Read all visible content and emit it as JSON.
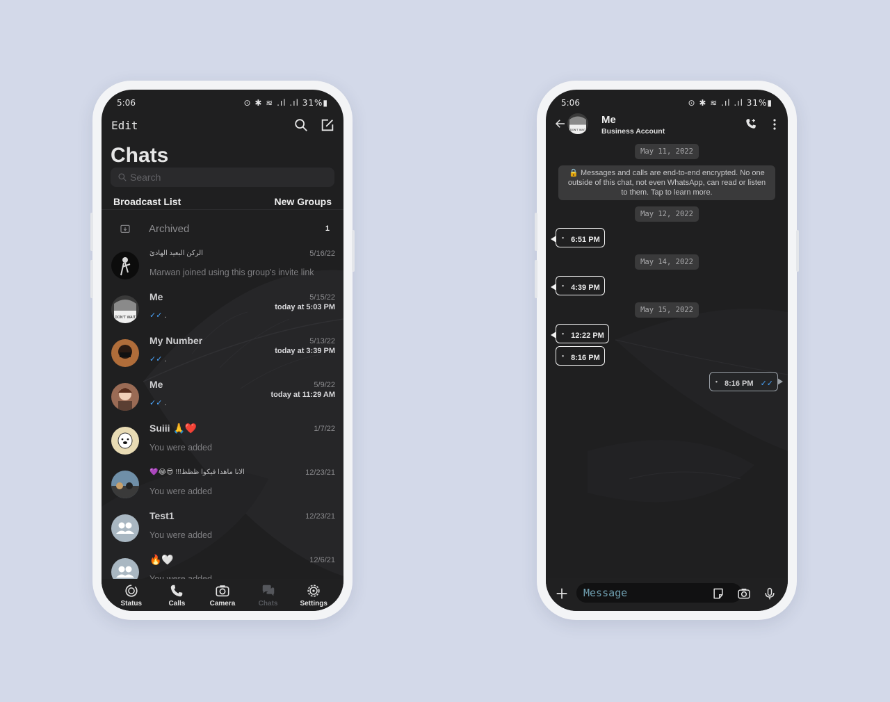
{
  "status": {
    "time": "5:06",
    "battery": "31%"
  },
  "left": {
    "edit": "Edit",
    "title": "Chats",
    "search_placeholder": "Search",
    "broadcast": "Broadcast List",
    "new_groups": "New Groups",
    "archived_label": "Archived",
    "archived_count": "1",
    "chats": [
      {
        "name": "الركن البعيد الهادئ",
        "date": "5/16/22",
        "sub": "",
        "preview": "Marwan joined using this group's invite link",
        "ticks": false
      },
      {
        "name": "Me",
        "date": "5/15/22",
        "sub": "today at 5:03 PM",
        "preview": "",
        "ticks": true
      },
      {
        "name": "My Number",
        "date": "5/13/22",
        "sub": "today at 3:39 PM",
        "preview": "",
        "ticks": true
      },
      {
        "name": "Me",
        "date": "5/9/22",
        "sub": "today at 11:29 AM",
        "preview": "",
        "ticks": true
      },
      {
        "name": "Suiii 🙏❤️",
        "date": "1/7/22",
        "sub": "",
        "preview": "You were added",
        "ticks": false
      },
      {
        "name": "💜😂😎 !!!الانا ماهدا فيكوا ظظظ",
        "date": "12/23/21",
        "sub": "",
        "preview": "You were added",
        "ticks": false
      },
      {
        "name": "Test1",
        "date": "12/23/21",
        "sub": "",
        "preview": "You were added",
        "ticks": false
      },
      {
        "name": "🔥🤍",
        "date": "12/6/21",
        "sub": "",
        "preview": "You were added",
        "ticks": false
      }
    ],
    "nav": [
      {
        "label": "Status"
      },
      {
        "label": "Calls"
      },
      {
        "label": "Camera"
      },
      {
        "label": "Chats"
      },
      {
        "label": "Settings"
      }
    ]
  },
  "right": {
    "contact_name": "Me",
    "contact_sub": "Business Account",
    "avatar_text": "DON'T WAIT",
    "date1": "May 11, 2022",
    "encryption": "🔒 Messages and calls are end-to-end encrypted. No one outside of this chat, not even WhatsApp, can read or listen to them. Tap to learn more.",
    "date2": "May 12, 2022",
    "msg1": "6:51 PM",
    "date3": "May 14, 2022",
    "msg2": "4:39 PM",
    "date4": "May 15, 2022",
    "msg3": "12:22 PM",
    "msg4": "8:16 PM",
    "msg5": "8:16 PM",
    "composer_placeholder": "Message"
  },
  "colors": {
    "screen_bg": "#1f1f20",
    "page_bg": "#d3d9e9",
    "tick_blue": "#4aa6ff"
  }
}
